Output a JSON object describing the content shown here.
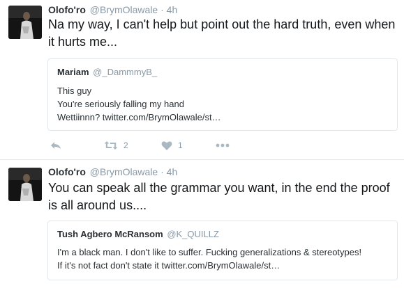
{
  "tweets": [
    {
      "author": {
        "name": "Olofo'ro",
        "handle": "@BrymOlawale"
      },
      "separator": "·",
      "time": "4h",
      "text": "Na my way, I can't help but point out the hard truth, even when it hurts me...",
      "quote": {
        "name": "Mariam",
        "handle": "@_DammmyB_",
        "lines": [
          "This guy",
          "You're seriously falling my hand",
          "Wettiinnn? twitter.com/BrymOlawale/st…"
        ]
      },
      "actions": {
        "retweets": "2",
        "likes": "1"
      }
    },
    {
      "author": {
        "name": "Olofo'ro",
        "handle": "@BrymOlawale"
      },
      "separator": "·",
      "time": "4h",
      "text": "You can speak all the grammar you want, in the end the proof is all around us....",
      "quote": {
        "name": "Tush Agbero McRansom",
        "handle": "@K_QUILLZ",
        "lines": [
          "I'm a black man. I don't like to suffer. Fucking generalizations & stereotypes!",
          "If it's not fact don't state it twitter.com/BrymOlawale/st…"
        ]
      }
    }
  ],
  "icons": {
    "reply": "reply-icon",
    "retweet": "retweet-icon",
    "like": "heart-icon",
    "more": "more-icon"
  },
  "colors": {
    "secondary_text": "#8899a6",
    "action_icon": "#aab8c2",
    "border": "#e1e8ed"
  }
}
